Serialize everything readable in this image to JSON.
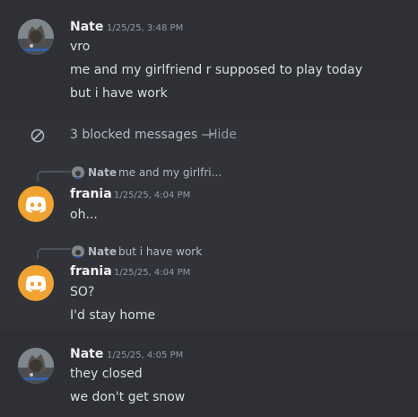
{
  "messages": [
    {
      "author": "Nate",
      "timestamp": "1/25/25, 3:48 PM",
      "lines": [
        "vro",
        "me and my girlfriend r supposed to play today",
        "but i have work"
      ]
    },
    {
      "author": "frania",
      "timestamp": "1/25/25, 4:04 PM",
      "reply_author": "Nate",
      "reply_text": "me and my girlfri...",
      "lines": [
        "oh..."
      ]
    },
    {
      "author": "frania",
      "timestamp": "1/25/25, 4:04 PM",
      "reply_author": "Nate",
      "reply_text": "but i have work",
      "lines": [
        "SO?",
        "I'd stay home"
      ]
    },
    {
      "author": "Nate",
      "timestamp": "1/25/25, 4:05 PM",
      "lines": [
        "they closed",
        "we don't get snow"
      ]
    }
  ],
  "blocked": {
    "text": "3 blocked messages —",
    "action": "Hide"
  },
  "colors": {
    "discord_avatar_bg": "#f0a232",
    "background": "#313338",
    "hover_background": "#2e3035"
  }
}
